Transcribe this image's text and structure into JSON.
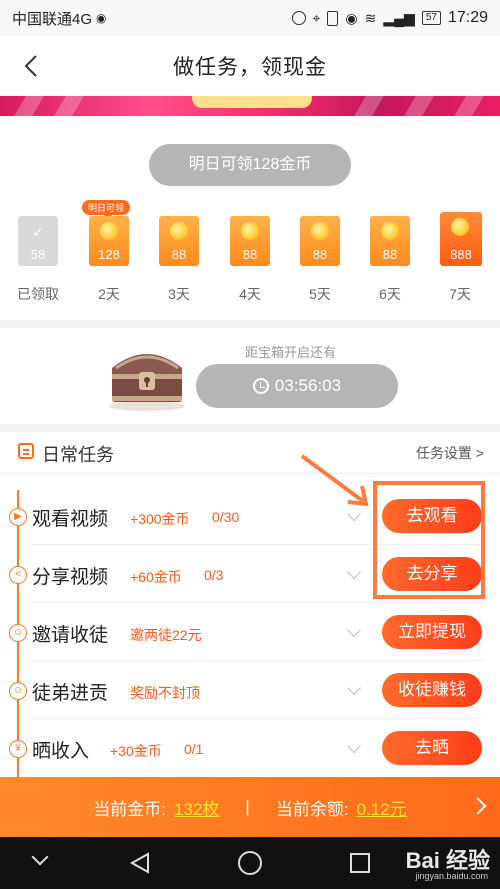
{
  "status_bar": {
    "carrier": "中国联通4G",
    "network": "4G",
    "battery": "57",
    "time": "17:29"
  },
  "nav": {
    "title": "做任务，领现金",
    "back_icon": "chevron-left-icon"
  },
  "checkin": {
    "tomorrow_label": "明日可领128金币",
    "tip_badge": "明日可领",
    "days": [
      {
        "value": "58",
        "label": "已领取",
        "state": "claimed"
      },
      {
        "value": "128",
        "label": "2天",
        "state": "normal"
      },
      {
        "value": "88",
        "label": "3天",
        "state": "normal"
      },
      {
        "value": "88",
        "label": "4天",
        "state": "normal"
      },
      {
        "value": "88",
        "label": "5天",
        "state": "normal"
      },
      {
        "value": "88",
        "label": "6天",
        "state": "normal"
      },
      {
        "value": "888",
        "label": "7天",
        "state": "big"
      }
    ]
  },
  "chest": {
    "subtitle": "距宝箱开启还有",
    "timer": "03:56:03"
  },
  "daily_tasks": {
    "title": "日常任务",
    "settings_label": "任务设置 >",
    "items": [
      {
        "icon": "play-icon",
        "name": "观看视频",
        "reward": "+300金币",
        "progress": "0/30",
        "button": "去观看"
      },
      {
        "icon": "share-icon",
        "name": "分享视频",
        "reward": "+60金币",
        "progress": "0/3",
        "button": "去分享"
      },
      {
        "icon": "user-icon",
        "name": "邀请收徒",
        "reward": "邀两徒22元",
        "progress": "",
        "button": "立即提现"
      },
      {
        "icon": "user-icon",
        "name": "徒弟进贡",
        "reward": "奖励不封顶",
        "progress": "",
        "button": "收徒赚钱"
      },
      {
        "icon": "yen-icon",
        "name": "晒收入",
        "reward": "+30金币",
        "progress": "0/1",
        "button": "去晒"
      }
    ]
  },
  "balance": {
    "coins_label": "当前金币:",
    "coins_value": "132枚",
    "separator": "|",
    "balance_label": "当前余额:",
    "balance_value": "0.12元"
  },
  "watermark": {
    "main": "Bai 经验",
    "sub": "jingyan.baidu.com"
  },
  "colors": {
    "accent": "#ff6a1a",
    "button": "#ff4d1a",
    "muted_pill": "#b5b5b5",
    "highlight": "#ffe633"
  }
}
